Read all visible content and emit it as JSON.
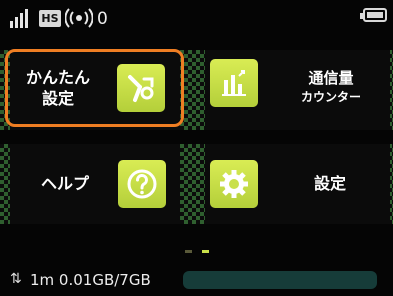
{
  "status_bar": {
    "signal_icon": "signal-bars-icon",
    "mode_badge": "HS",
    "wifi_icon": "wifi-broadcast-icon",
    "connected_clients": "0",
    "battery_icon": "battery-icon",
    "battery_level": 1.0
  },
  "menu": {
    "easy_setup": {
      "label_line1": "かんたん",
      "label_line2": "設定",
      "icon": "wrench-icon"
    },
    "usage_counter": {
      "label_line1": "通信量",
      "label_line2": "カウンター",
      "icon": "bar-chart-icon"
    },
    "help": {
      "label": "ヘルプ",
      "icon": "question-icon"
    },
    "settings": {
      "label": "設定",
      "icon": "gear-icon"
    }
  },
  "page_indicator": {
    "pages": 2,
    "current": 1
  },
  "data_usage": {
    "arrows": "⇅",
    "text": "1m 0.01GB/7GB",
    "fraction": 0.0
  },
  "colors": {
    "tile": "#c9e04a",
    "focus": "#ef7e23",
    "pattern": "#2f5f2f",
    "usage_bar_bg": "#163c39"
  }
}
